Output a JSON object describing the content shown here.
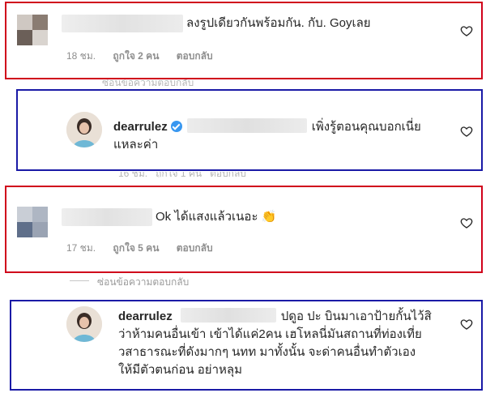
{
  "comments": [
    {
      "text": "ลงรูปเดียวกันพร้อมกัน. กับ. Goyเลย",
      "time": "18 ชม.",
      "likes": "ถูกใจ 2 คน",
      "reply": "ตอบกลับ"
    },
    {
      "username": "dearrulez",
      "text_line1": "เพิ่งรู้ตอนคุณบอกเนี่ย",
      "text_line2": "แหละค่า"
    },
    {
      "text": "Ok ได้แสงแล้วเนอะ",
      "emoji": "👏",
      "time": "17 ชม.",
      "likes": "ถูกใจ 5 คน",
      "reply": "ตอบกลับ"
    },
    {
      "username": "dearrulez",
      "text_line1": "ปดูอ ปะ บินมาเอาป้ายกั้นไว้สิ",
      "text_line2": "ว่าห้ามคนอื่นเข้า เข้าได้แค่2คน เฮโหลนี่มันสถานที่ท่องเที่ย",
      "text_line3": "วสาธารณะที่ดังมากๆ นทท มาทั้งนั้น จะด่าคนอื่นทำตัวเอง",
      "text_line4": "ให้มีตัวตนก่อน อย่าหลุม"
    }
  ],
  "hide_replies": "ซ่อนข้อความตอบกลับ"
}
